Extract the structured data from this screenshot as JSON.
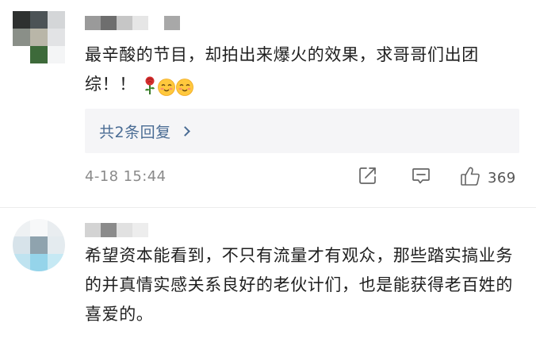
{
  "comments": [
    {
      "text": "最辛酸的节目，却拍出来爆火的效果，求哥哥们出团综！！",
      "emojis": [
        "rose-icon",
        "smile-icon",
        "smile-icon"
      ],
      "reply_label": "共2条回复",
      "timestamp": "4-18 15:44",
      "like_count": "369"
    },
    {
      "text": "希望资本能看到，不只有流量才有观众，那些踏实搞业务的并真情实感关系良好的老伙计们，也是能获得老百姓的喜爱的。"
    }
  ],
  "icons": {
    "share": "share-icon",
    "comment": "comment-icon",
    "like": "thumbs-up-icon",
    "expand": "chevron-right-icon"
  },
  "colors": {
    "link": "#4a6c94",
    "reply_bg": "#f5f5f7",
    "meta_text": "#8a8a8a"
  }
}
